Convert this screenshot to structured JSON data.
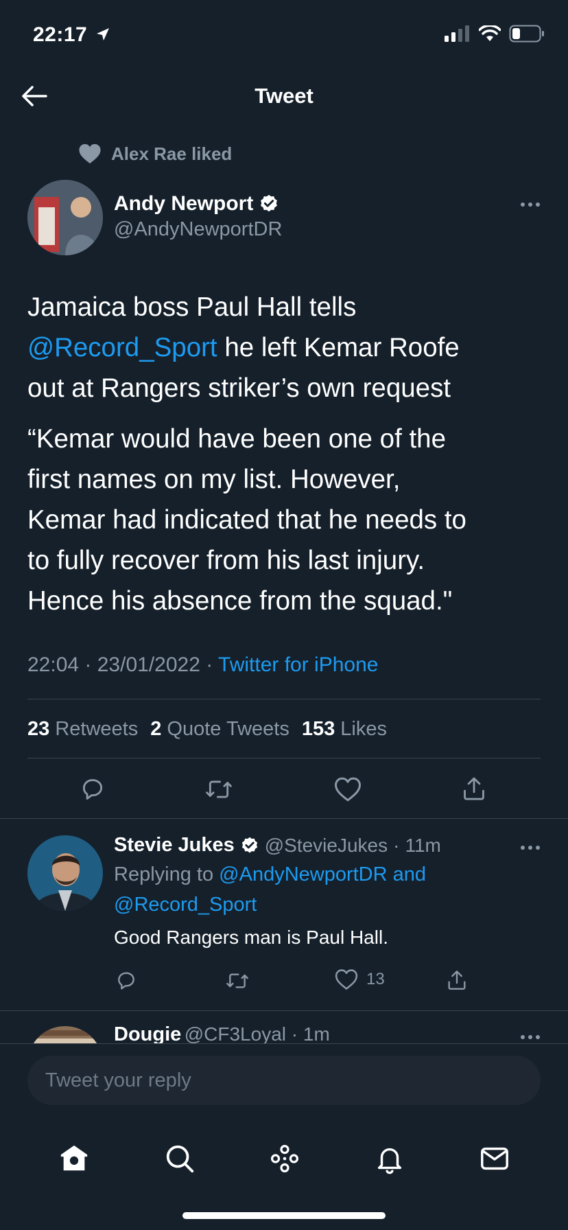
{
  "status_bar": {
    "time": "22:17"
  },
  "header": {
    "title": "Tweet"
  },
  "social_context": {
    "text": "Alex Rae liked"
  },
  "tweet": {
    "author_name": "Andy Newport",
    "author_handle": "@AndyNewportDR",
    "text_line1": "Jamaica boss Paul Hall tells",
    "mention": "@Record_Sport",
    "text_line2_rest": " he left Kemar Roofe",
    "text_line3": "out at Rangers striker’s own request",
    "quote_lines": [
      "“Kemar would have been one of the",
      "first names on my list. However,",
      "Kemar had indicated that he needs to",
      "to fully recover from his last injury.",
      "Hence his absence from the squad.\""
    ],
    "time": "22:04",
    "date": "23/01/2022",
    "source": "Twitter for iPhone",
    "retweets_count": "23",
    "retweets_label": "Retweets",
    "quotes_count": "2",
    "quotes_label": "Quote Tweets",
    "likes_count": "153",
    "likes_label": "Likes"
  },
  "replies": [
    {
      "name": "Stevie Jukes",
      "handle": "@StevieJukes",
      "age": "11m",
      "replying_prefix": "Replying to",
      "replying_to_1": "@AndyNewportDR and",
      "replying_to_2": "@Record_Sport",
      "text": "Good Rangers man is Paul Hall.",
      "like_count": "13"
    },
    {
      "name": "Dougie",
      "handle": "@CF3Loyal",
      "age": "1m"
    }
  ],
  "composer": {
    "placeholder": "Tweet your reply"
  },
  "colors": {
    "background": "#15202b",
    "accent": "#1d9bf0",
    "muted": "#8b98a5"
  }
}
